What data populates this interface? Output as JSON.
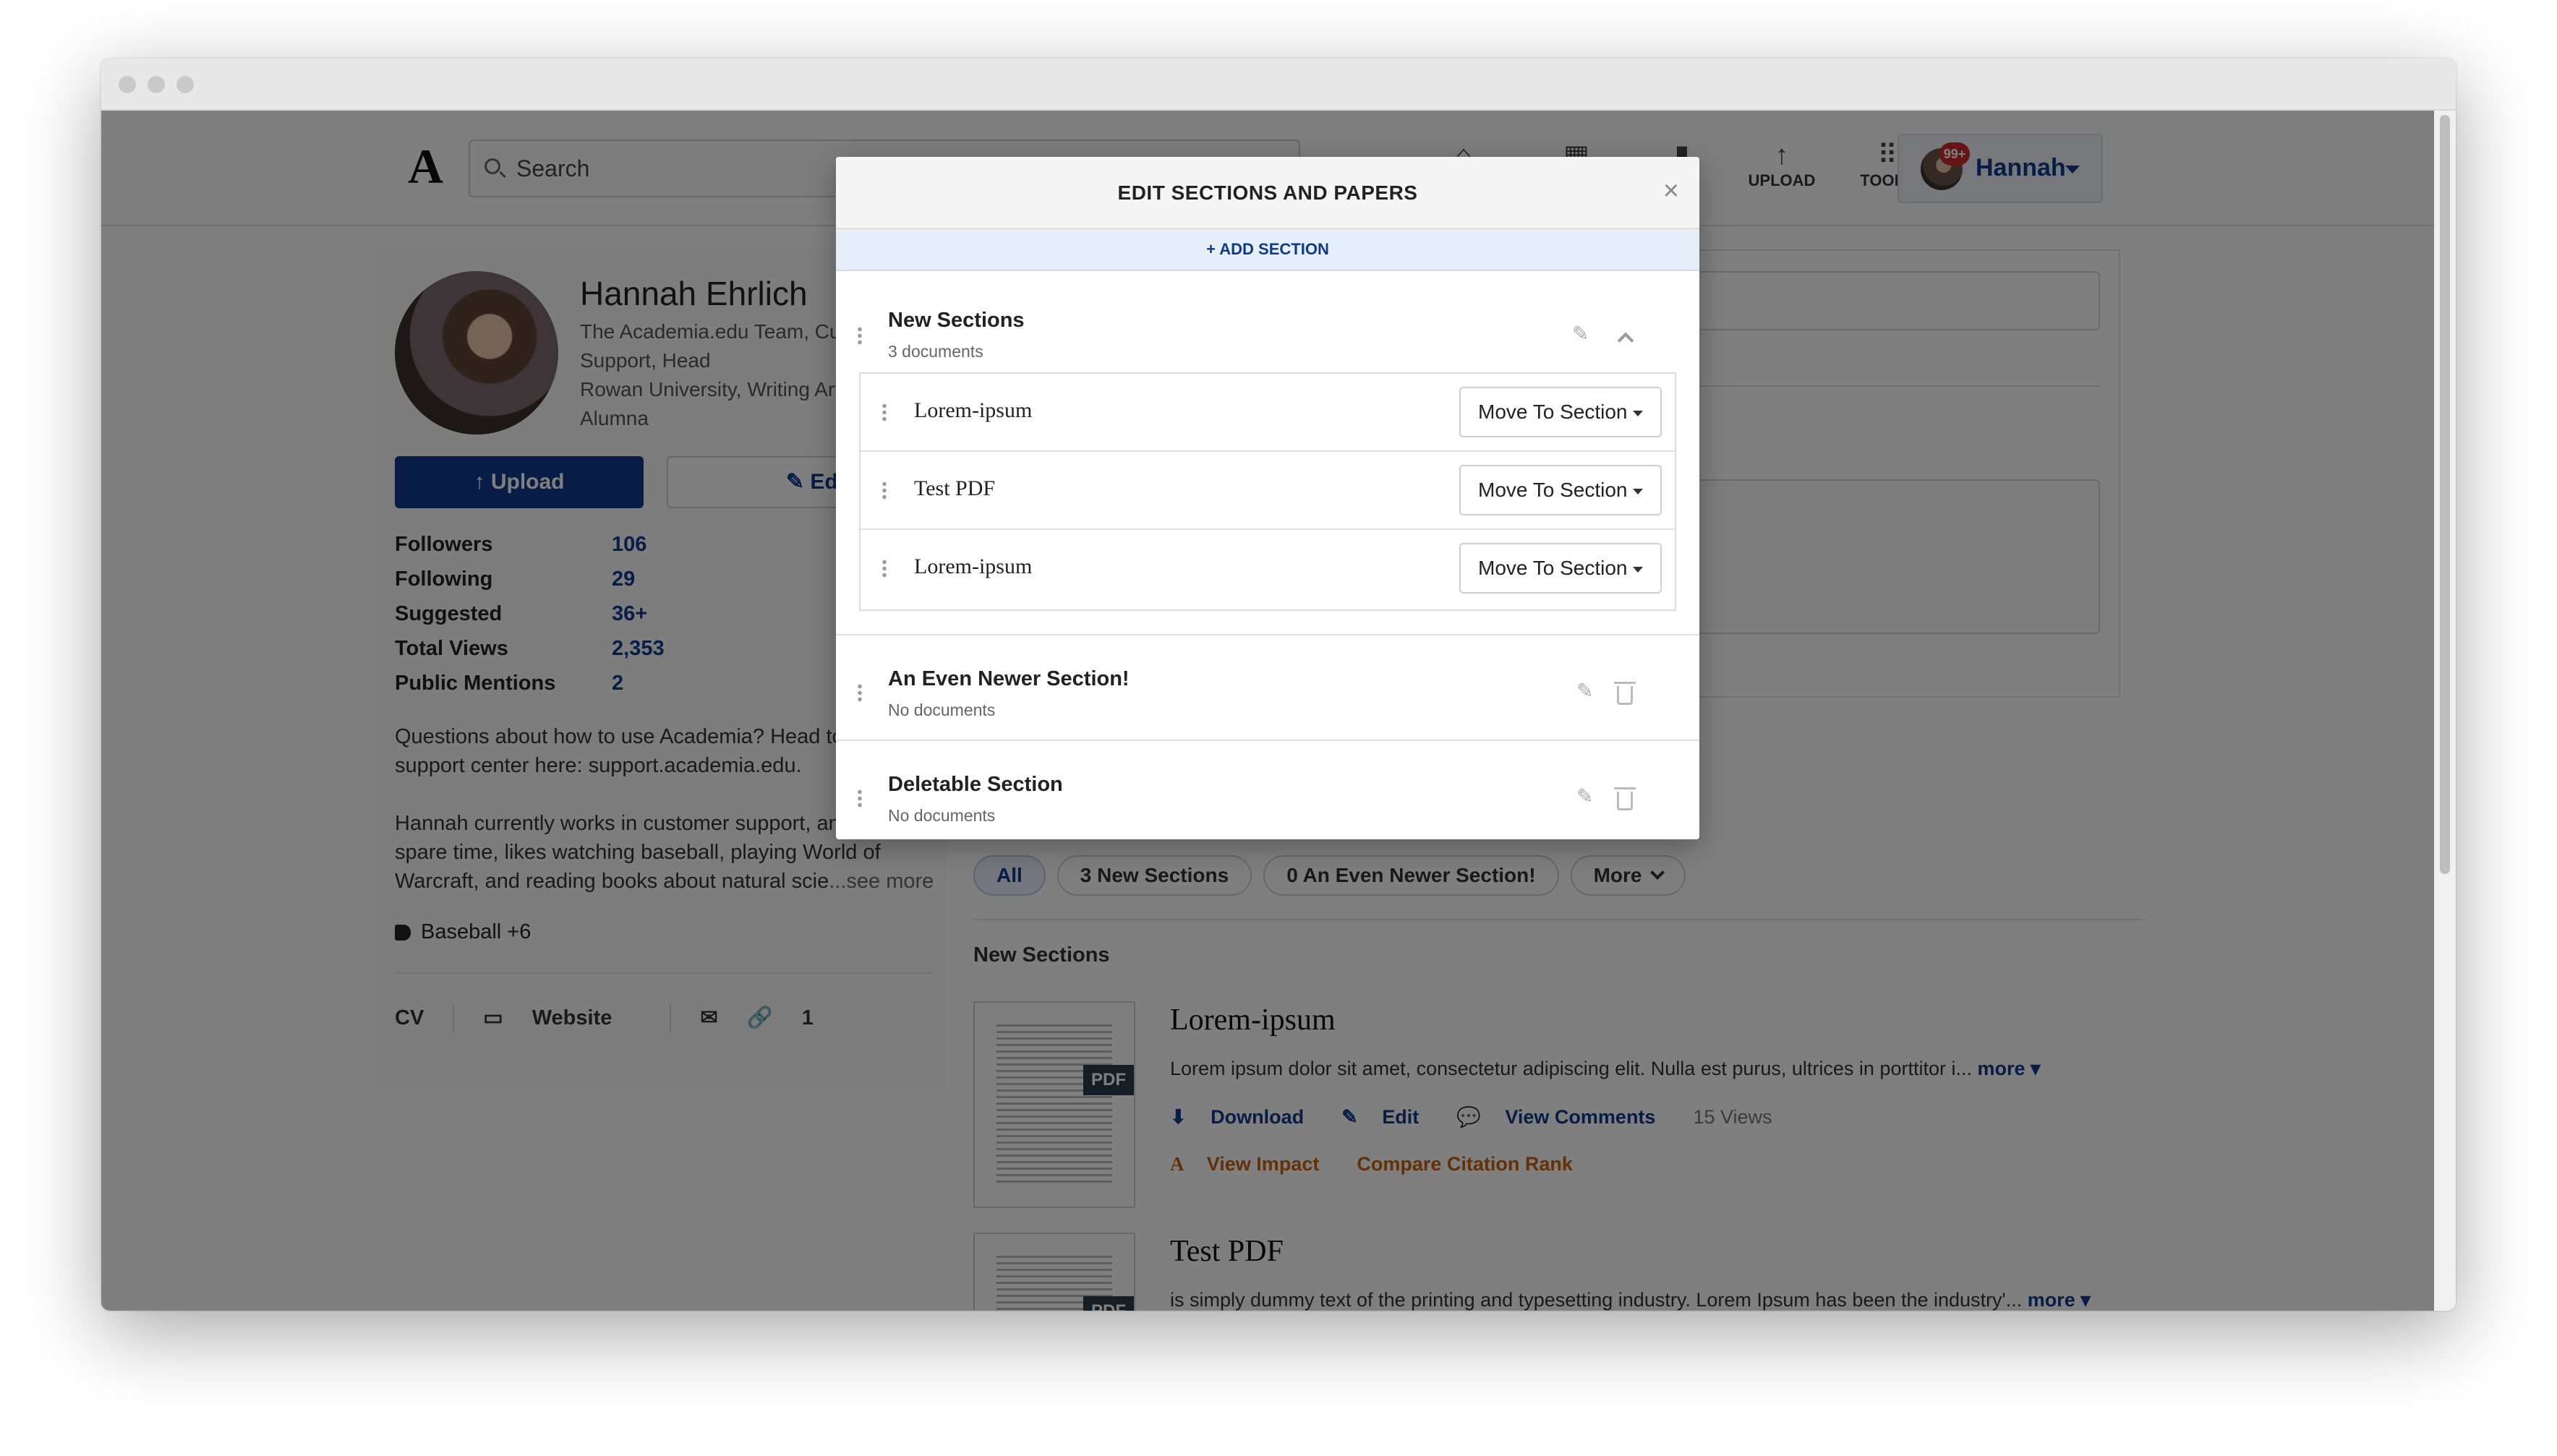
{
  "header": {
    "logo": "A",
    "search_placeholder": "Search",
    "nav": [
      {
        "icon": "home-icon",
        "glyph": "⌂",
        "label": ""
      },
      {
        "icon": "grid-icon",
        "glyph": "▦",
        "label": ""
      },
      {
        "icon": "analytics-icon",
        "glyph": "▮",
        "label": ""
      },
      {
        "icon": "upload-icon",
        "glyph": "↑",
        "label": "UPLOAD"
      },
      {
        "icon": "tools-icon",
        "glyph": "⠿",
        "label": "TOOLS"
      }
    ],
    "notifications_badge": "99+",
    "user_name": "Hannah"
  },
  "profile": {
    "name": "Hannah Ehrlich",
    "affiliation_1": "The Academia.edu Team, Cu",
    "affiliation_2": "Support, Head",
    "affiliation_3": "Rowan University, Writing Art",
    "affiliation_4": "Alumna",
    "upload_label": "Upload",
    "edit_label": "Edit",
    "stats": [
      {
        "label": "Followers",
        "value": "106"
      },
      {
        "label": "Following",
        "value": "29"
      },
      {
        "label": "Suggested",
        "value": "36+"
      },
      {
        "label": "Total Views",
        "value": "2,353"
      },
      {
        "label": "Public Mentions",
        "value": "2"
      }
    ],
    "bio_1": "Questions about how to use Academia? Head to",
    "bio_2": "support center here: support.academia.edu.",
    "bio_3": "Hannah currently works in customer support, and",
    "bio_4": "spare time, likes watching baseball, playing World of",
    "bio_5": "Warcraft, and reading books about natural scie",
    "see_more": "...see more",
    "tags": "Baseball +6",
    "links": {
      "cv": "CV",
      "website": "Website",
      "links_count": "1"
    }
  },
  "content": {
    "filters": [
      {
        "label": "All",
        "active": true
      },
      {
        "label": "3 New Sections",
        "active": false
      },
      {
        "label": "0 An Even Newer Section!",
        "active": false
      },
      {
        "label": "More",
        "active": false
      }
    ],
    "section_label": "New Sections",
    "documents": [
      {
        "title": "Lorem-ipsum",
        "snippet": "Lorem ipsum dolor sit amet, consectetur adipiscing elit. Nulla est purus, ultrices in porttitor i...",
        "more": "more",
        "download": "Download",
        "edit": "Edit",
        "comments": "View Comments",
        "views": "15 Views",
        "impact": "View Impact",
        "citation": "Compare Citation Rank"
      },
      {
        "title": "Test PDF",
        "snippet": "is simply dummy text of the printing and typesetting industry. Lorem Ipsum has been the industry'...",
        "more": "more"
      }
    ],
    "pdf_badge": "PDF"
  },
  "modal": {
    "title": "EDIT SECTIONS AND PAPERS",
    "close": "×",
    "add_section": "+ ADD SECTION",
    "sections": [
      {
        "name": "New Sections",
        "count": "3 documents"
      },
      {
        "name": "An Even Newer Section!",
        "count": "No documents"
      },
      {
        "name": "Deletable Section",
        "count": "No documents"
      }
    ],
    "docs": [
      {
        "name": "Lorem-ipsum",
        "action": "Move To Section"
      },
      {
        "name": "Test PDF",
        "action": "Move To Section"
      },
      {
        "name": "Lorem-ipsum",
        "action": "Move To Section"
      }
    ]
  }
}
